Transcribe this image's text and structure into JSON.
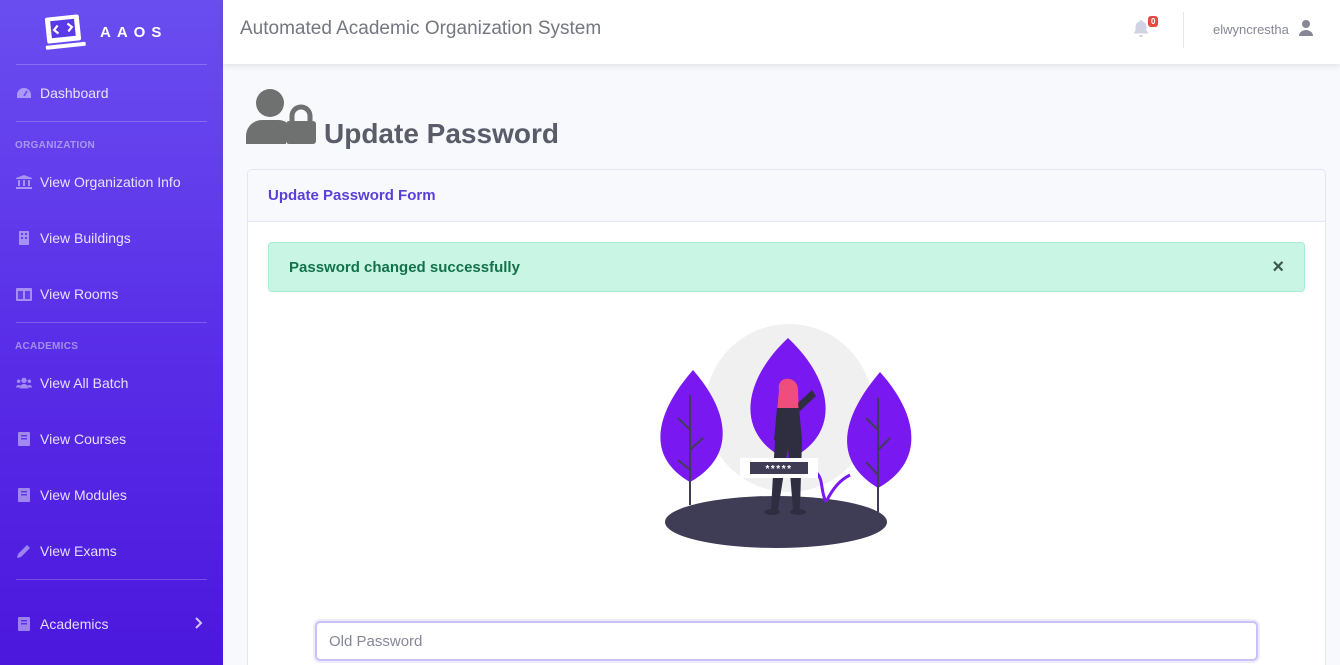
{
  "brand": {
    "name": "AAOS",
    "logo_icon": "laptop-code-icon"
  },
  "sidebar": {
    "dashboard": "Dashboard",
    "headings": {
      "organization": "ORGANIZATION",
      "academics": "ACADEMICS"
    },
    "items": [
      {
        "label": "View Organization Info",
        "icon": "university-icon"
      },
      {
        "label": "View Buildings",
        "icon": "building-icon"
      },
      {
        "label": "View Rooms",
        "icon": "columns-icon"
      },
      {
        "label": "View All Batch",
        "icon": "users-icon"
      },
      {
        "label": "View Courses",
        "icon": "book-icon"
      },
      {
        "label": "View Modules",
        "icon": "book-icon"
      },
      {
        "label": "View Exams",
        "icon": "pencil-icon"
      },
      {
        "label": "Academics",
        "icon": "book-icon"
      }
    ]
  },
  "topbar": {
    "title": "Automated Academic Organization System",
    "notification_count": "0",
    "username": "elwyncrestha"
  },
  "page": {
    "title": "Update Password"
  },
  "card": {
    "header": "Update Password Form",
    "alert": "Password changed successfully",
    "alert_close": "×",
    "password_mask": "*****",
    "old_password_placeholder": "Old Password"
  },
  "colors": {
    "sidebar_top": "#6a4ef0",
    "sidebar_bottom": "#4b17dd",
    "accent": "#5a3fd8",
    "success_bg": "#c9f5e5",
    "success_text": "#13724c",
    "illustration_purple": "#7a18f2"
  }
}
